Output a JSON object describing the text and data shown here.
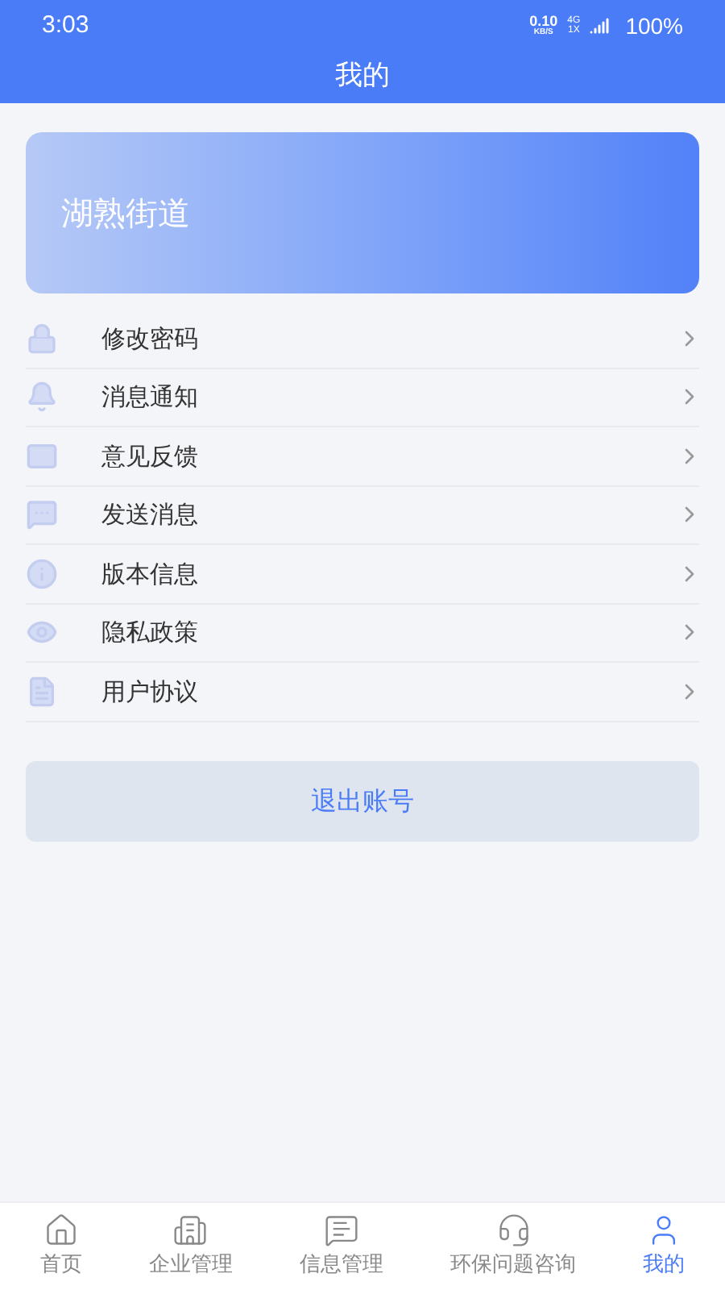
{
  "status_bar": {
    "time": "3:03",
    "speed": "0.10",
    "speed_unit": "KB/S",
    "network_top": "4G",
    "network_bottom": "1X",
    "battery": "100%"
  },
  "header": {
    "title": "我的"
  },
  "profile_card": {
    "name": "湖熟街道"
  },
  "menu": [
    {
      "label": "修改密码"
    },
    {
      "label": "消息通知"
    },
    {
      "label": "意见反馈"
    },
    {
      "label": "发送消息"
    },
    {
      "label": "版本信息"
    },
    {
      "label": "隐私政策"
    },
    {
      "label": "用户协议"
    }
  ],
  "logout_button": "退出账号",
  "tab_bar": [
    {
      "label": "首页",
      "selected": false
    },
    {
      "label": "企业管理",
      "selected": false
    },
    {
      "label": "信息管理",
      "selected": false
    },
    {
      "label": "环保问题咨询",
      "selected": false
    },
    {
      "label": "我的",
      "selected": true
    }
  ]
}
